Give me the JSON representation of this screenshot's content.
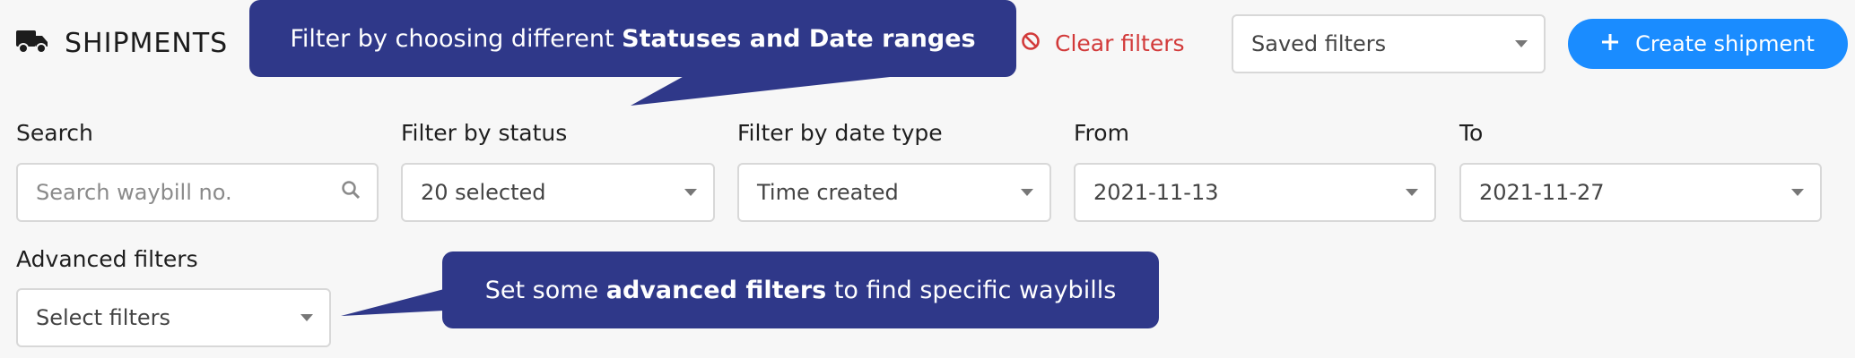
{
  "header": {
    "title": "SHIPMENTS",
    "title_icon": "truck-icon",
    "clear_filters_label": "Clear filters",
    "clear_icon": "ban-icon",
    "saved_filters_value": "Saved filters",
    "create_shipment_label": "Create shipment",
    "create_icon": "plus-icon"
  },
  "filters": {
    "search": {
      "label": "Search",
      "placeholder": "Search waybill no."
    },
    "status": {
      "label": "Filter by status",
      "value": "20 selected"
    },
    "date_type": {
      "label": "Filter by date type",
      "value": "Time created"
    },
    "from": {
      "label": "From",
      "value": "2021-11-13"
    },
    "to": {
      "label": "To",
      "value": "2021-11-27"
    },
    "advanced": {
      "label": "Advanced filters",
      "placeholder": "Select filters"
    }
  },
  "callouts": {
    "top": {
      "prefix": "Filter by choosing different ",
      "bold": "Statuses and Date ranges",
      "suffix": ""
    },
    "bottom": {
      "prefix": "Set some ",
      "bold": "advanced filters",
      "suffix": " to find specific waybills"
    }
  },
  "colors": {
    "callout_bg": "#2f3889",
    "primary": "#1a8cff",
    "danger": "#d23a3a",
    "page_bg": "#f7f7f7"
  }
}
